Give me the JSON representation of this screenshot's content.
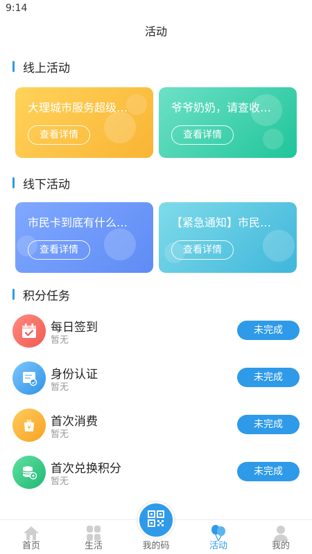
{
  "status_bar": {
    "time": "9:14"
  },
  "header": {
    "title": "活动"
  },
  "online": {
    "title": "线上活动",
    "cards": [
      {
        "title": "大理城市服务超级…",
        "button": "查看详情"
      },
      {
        "title": "爷爷奶奶，请查收…",
        "button": "查看详情"
      }
    ]
  },
  "offline": {
    "title": "线下活动",
    "cards": [
      {
        "title": "市民卡到底有什么…",
        "button": "查看详情"
      },
      {
        "title": "【紧急通知】市民…",
        "button": "查看详情"
      }
    ]
  },
  "tasks": {
    "title": "积分任务",
    "items": [
      {
        "name": "每日签到",
        "sub": "暂无",
        "button": "未完成",
        "icon": "calendar-check-icon"
      },
      {
        "name": "身份认证",
        "sub": "暂无",
        "button": "未完成",
        "icon": "id-card-icon"
      },
      {
        "name": "首次消费",
        "sub": "暂无",
        "button": "未完成",
        "icon": "yuan-bag-icon"
      },
      {
        "name": "首次兑换积分",
        "sub": "暂无",
        "button": "未完成",
        "icon": "coins-icon"
      }
    ]
  },
  "tabbar": {
    "items": [
      {
        "label": "首页",
        "icon": "home-icon"
      },
      {
        "label": "生活",
        "icon": "life-grid-icon"
      },
      {
        "label": "我的码",
        "icon": "qr-code-icon"
      },
      {
        "label": "活动",
        "icon": "balloon-icon",
        "active": true
      },
      {
        "label": "我的",
        "icon": "user-icon"
      }
    ]
  },
  "colors": {
    "accent": "#2e9ae8",
    "text": "#222222",
    "muted": "#999999"
  }
}
